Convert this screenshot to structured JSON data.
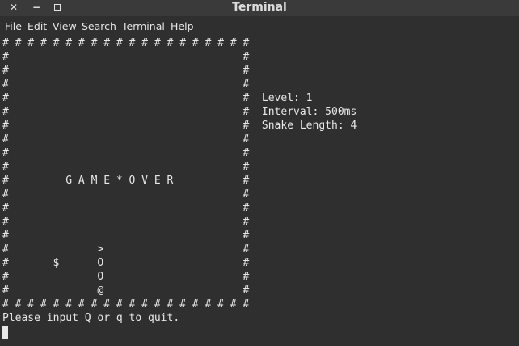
{
  "window": {
    "title": "Terminal",
    "close_glyph": "✕",
    "minimize_glyph": "−"
  },
  "menu": {
    "file": "File",
    "edit": "Edit",
    "view": "View",
    "search": "Search",
    "terminal": "Terminal",
    "help": "Help"
  },
  "terminal": {
    "lines": [
      "# # # # # # # # # # # # # # # # # # # #",
      "#                                     #",
      "#                                     #",
      "#                                     #",
      "#                                     #  Level: 1",
      "#                                     #  Interval: 500ms",
      "#                                     #  Snake Length: 4",
      "#                                     #",
      "#                                     #",
      "#                                     #",
      "#         G A M E * O V E R           #",
      "#                                     #",
      "#                                     #",
      "#                                     #",
      "#                                     #",
      "#              >                      #",
      "#       $      O                      #",
      "#              O                      #",
      "#              @                      #",
      "# # # # # # # # # # # # # # # # # # # #",
      "Please input Q or q to quit."
    ]
  }
}
